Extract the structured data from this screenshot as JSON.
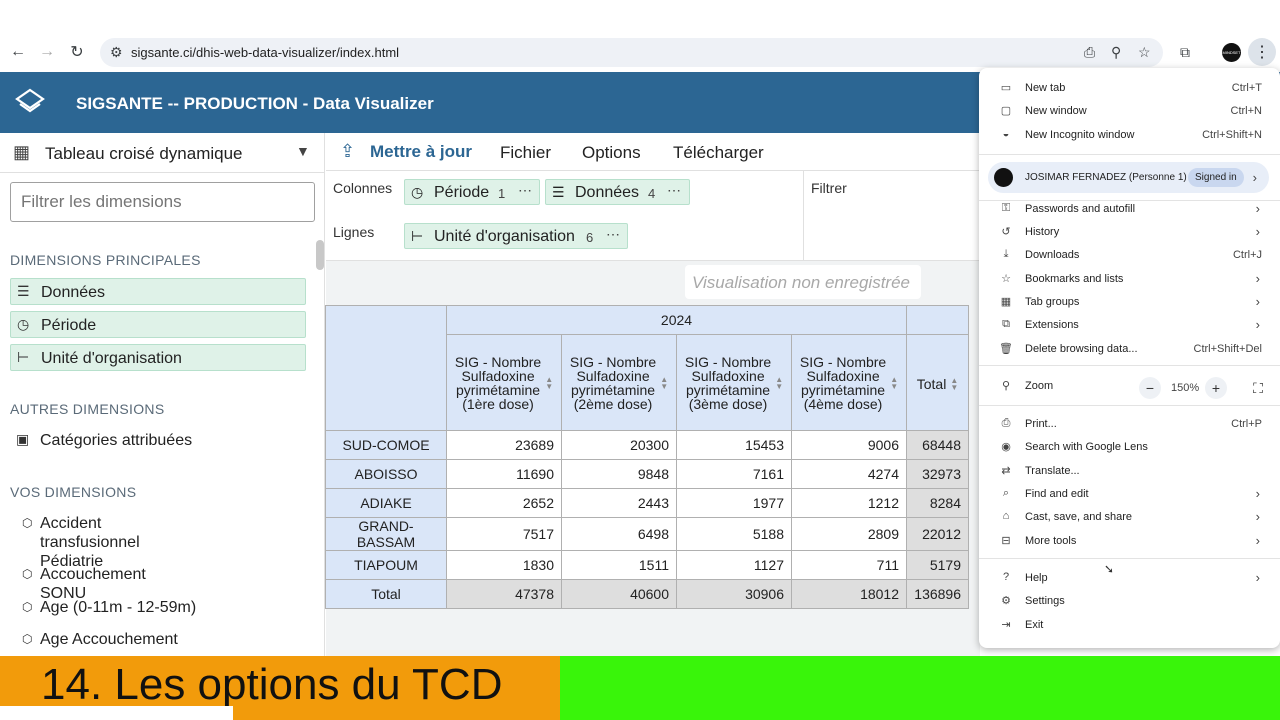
{
  "browser": {
    "url": "sigsante.ci/dhis-web-data-visualizer/index.html",
    "avatar_text": "MINDSET"
  },
  "app": {
    "title": "SIGSANTE -- PRODUCTION - Data Visualizer"
  },
  "left_panel": {
    "vis_type": "Tableau croisé dynamique",
    "filter_placeholder": "Filtrer les dimensions",
    "main_header": "DIMENSIONS PRINCIPALES",
    "main_dims": [
      "Données",
      "Période",
      "Unité d'organisation"
    ],
    "other_header": "AUTRES DIMENSIONS",
    "other_dims": [
      "Catégories attribuées"
    ],
    "your_header": "VOS DIMENSIONS",
    "your_dims": [
      "Accident transfusionnel\nPédiatrie",
      "Accouchement SONU",
      "Age (0-11m - 12-59m)",
      "Age Accouchement"
    ]
  },
  "menubar": {
    "update": "Mettre à jour",
    "file": "Fichier",
    "options": "Options",
    "download": "Télécharger"
  },
  "layout": {
    "columns_label": "Colonnes",
    "rows_label": "Lignes",
    "filter_label": "Filtrer",
    "chip_period": "Période",
    "chip_period_count": "1",
    "chip_data": "Données",
    "chip_data_count": "4",
    "chip_org": "Unité d'organisation",
    "chip_org_count": "6",
    "more": "⋯"
  },
  "unsaved": "Visualisation non enregistrée",
  "pivot": {
    "year": "2024",
    "columns": [
      "SIG - Nombre\nSulfadoxine\npyrimétamine\n(1ère dose)",
      "SIG - Nombre\nSulfadoxine\npyrimétamine\n(2ème dose)",
      "SIG - Nombre\nSulfadoxine\npyrimétamine\n(3ème dose)",
      "SIG - Nombre\nSulfadoxine\npyrimétamine\n(4ème dose)"
    ],
    "total_label": "Total",
    "rows": [
      {
        "label": "SUD-COMOE",
        "values": [
          "23689",
          "20300",
          "15453",
          "9006"
        ],
        "total": "68448"
      },
      {
        "label": "ABOISSO",
        "values": [
          "11690",
          "9848",
          "7161",
          "4274"
        ],
        "total": "32973"
      },
      {
        "label": "ADIAKE",
        "values": [
          "2652",
          "2443",
          "1977",
          "1212"
        ],
        "total": "8284"
      },
      {
        "label": "GRAND-BASSAM",
        "values": [
          "7517",
          "6498",
          "5188",
          "2809"
        ],
        "total": "22012"
      },
      {
        "label": "TIAPOUM",
        "values": [
          "1830",
          "1511",
          "1127",
          "711"
        ],
        "total": "5179"
      }
    ],
    "totals_row": {
      "label": "Total",
      "values": [
        "47378",
        "40600",
        "30906",
        "18012"
      ],
      "total": "136896"
    }
  },
  "chrome_menu": {
    "new_tab": "New tab",
    "new_tab_key": "Ctrl+T",
    "new_window": "New window",
    "new_window_key": "Ctrl+N",
    "incognito": "New Incognito window",
    "incognito_key": "Ctrl+Shift+N",
    "profile_name": "JOSIMAR FERNADEZ (Personne 1)",
    "signed_in": "Signed in",
    "passwords": "Passwords and autofill",
    "history": "History",
    "downloads": "Downloads",
    "downloads_key": "Ctrl+J",
    "bookmarks": "Bookmarks and lists",
    "tab_groups": "Tab groups",
    "extensions": "Extensions",
    "delete_data": "Delete browsing data...",
    "delete_data_key": "Ctrl+Shift+Del",
    "zoom": "Zoom",
    "zoom_value": "150%",
    "print": "Print...",
    "print_key": "Ctrl+P",
    "lens": "Search with Google Lens",
    "translate": "Translate...",
    "find": "Find and edit",
    "cast": "Cast, save, and share",
    "more_tools": "More tools",
    "help": "Help",
    "settings": "Settings",
    "exit": "Exit"
  },
  "banner": {
    "text": "14. Les options du TCD"
  },
  "colors": {
    "header_blue": "#2c6693",
    "chip_green": "#dff2e8",
    "banner_orange": "#f29b0b",
    "banner_green": "#39f50a"
  }
}
